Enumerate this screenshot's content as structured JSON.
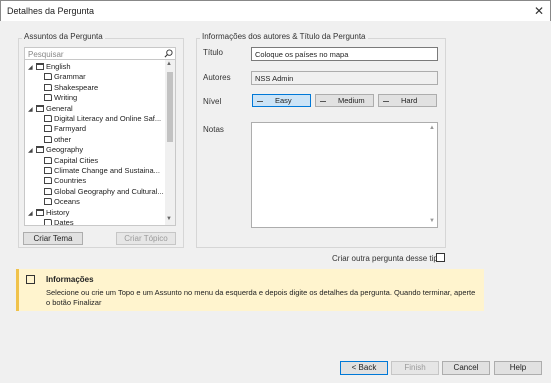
{
  "window": {
    "title": "Detalhes da Pergunta",
    "close_glyph": "✕"
  },
  "left_panel": {
    "title": "Assuntos da Pergunta",
    "search_placeholder": "Pesquisar",
    "tree": [
      {
        "label": "English",
        "level": 0,
        "type": "folder",
        "expanded": true
      },
      {
        "label": "Grammar",
        "level": 1,
        "type": "doc"
      },
      {
        "label": "Shakespeare",
        "level": 1,
        "type": "doc"
      },
      {
        "label": "Writing",
        "level": 1,
        "type": "doc"
      },
      {
        "label": "General",
        "level": 0,
        "type": "folder",
        "expanded": true
      },
      {
        "label": "Digital Literacy and Online Saf...",
        "level": 1,
        "type": "doc"
      },
      {
        "label": "Farmyard",
        "level": 1,
        "type": "doc"
      },
      {
        "label": "other",
        "level": 1,
        "type": "doc"
      },
      {
        "label": "Geography",
        "level": 0,
        "type": "folder",
        "expanded": true
      },
      {
        "label": "Capital Cities",
        "level": 1,
        "type": "doc"
      },
      {
        "label": "Climate Change and Sustaina...",
        "level": 1,
        "type": "doc"
      },
      {
        "label": "Countries",
        "level": 1,
        "type": "doc"
      },
      {
        "label": "Global Geography and Cultural...",
        "level": 1,
        "type": "doc"
      },
      {
        "label": "Oceans",
        "level": 1,
        "type": "doc"
      },
      {
        "label": "History",
        "level": 0,
        "type": "folder",
        "expanded": true
      },
      {
        "label": "Dates",
        "level": 1,
        "type": "doc"
      }
    ],
    "create_topic_btn": "Criar Tema",
    "create_subject_btn": "Criar Tópico"
  },
  "right_panel": {
    "title": "Informações dos autores & Título da Pergunta",
    "title_label": "Título",
    "title_value": "Coloque os países no mapa",
    "authors_label": "Autores",
    "authors_value": "NSS Admin",
    "level_label": "Nível",
    "levels": [
      "Easy",
      "Medium",
      "Hard"
    ],
    "selected_level": "Easy",
    "notes_label": "Notas",
    "notes_value": ""
  },
  "create_another": {
    "label": "Criar outra pergunta desse tipo",
    "checked": false
  },
  "info": {
    "title": "Informações",
    "message": "Selecione ou crie um Topo e um Assunto no menu da esquerda e depois digite os detalhes da pergunta. Quando terminar, aperte o botão Finalizar"
  },
  "footer": {
    "back": "< Back",
    "finish": "Finish",
    "cancel": "Cancel",
    "help": "Help"
  },
  "colors": {
    "accent": "#0078d7",
    "info_bg": "#fff4ce",
    "selected_bg": "#cce4f7"
  }
}
